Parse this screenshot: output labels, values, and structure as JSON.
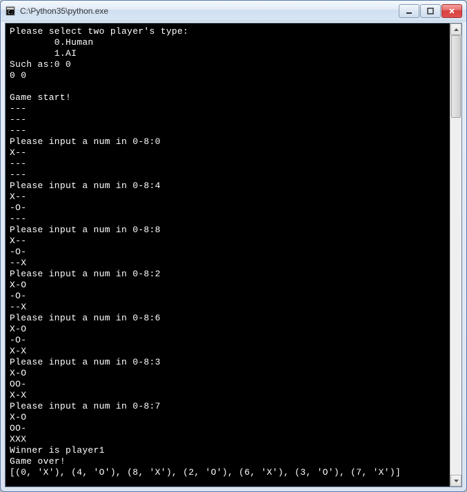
{
  "window": {
    "title": "C:\\Python35\\python.exe"
  },
  "console": {
    "lines": [
      "Please select two player's type:",
      "        0.Human",
      "        1.AI",
      "Such as:0 0",
      "0 0",
      "",
      "Game start!",
      "---",
      "---",
      "---",
      "Please input a num in 0-8:0",
      "X--",
      "---",
      "---",
      "Please input a num in 0-8:4",
      "X--",
      "-O-",
      "---",
      "Please input a num in 0-8:8",
      "X--",
      "-O-",
      "--X",
      "Please input a num in 0-8:2",
      "X-O",
      "-O-",
      "--X",
      "Please input a num in 0-8:6",
      "X-O",
      "-O-",
      "X-X",
      "Please input a num in 0-8:3",
      "X-O",
      "OO-",
      "X-X",
      "Please input a num in 0-8:7",
      "X-O",
      "OO-",
      "XXX",
      "Winner is player1",
      "Game over!",
      "[(0, 'X'), (4, 'O'), (8, 'X'), (2, 'O'), (6, 'X'), (3, 'O'), (7, 'X')]"
    ]
  }
}
